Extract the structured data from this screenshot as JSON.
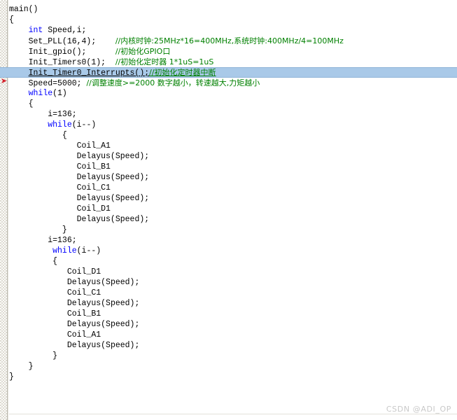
{
  "editor": {
    "gutter_marker_icon": "red-execution-arrow",
    "watermark": "CSDN @ADI_OP",
    "colors": {
      "keyword": "#0000ff",
      "comment": "#008000",
      "text": "#000000",
      "selection": "#a9c9e8",
      "gutter": "#fbfbf9",
      "marker": "#d4202a",
      "watermark": "#c9c9c9"
    }
  },
  "code": {
    "lines": [
      {
        "indent": 0,
        "parts": [
          {
            "t": "main()",
            "c": "plain"
          }
        ]
      },
      {
        "indent": 0,
        "parts": [
          {
            "t": "{",
            "c": "plain"
          }
        ]
      },
      {
        "indent": 4,
        "parts": [
          {
            "t": "int",
            "c": "kw"
          },
          {
            "t": " Speed,i;",
            "c": "plain"
          }
        ]
      },
      {
        "indent": 4,
        "parts": [
          {
            "t": "Set_PLL(16,4);    ",
            "c": "plain"
          },
          {
            "t": "//内核时钟:25MHz*16=400MHz,系统时钟:400MHz/4=100MHz",
            "c": "cmt"
          }
        ]
      },
      {
        "indent": 4,
        "parts": [
          {
            "t": "Init_gpio();      ",
            "c": "plain"
          },
          {
            "t": "//初始化GPIO口",
            "c": "cmt"
          }
        ]
      },
      {
        "indent": 4,
        "parts": [
          {
            "t": "Init_Timers0(1);  ",
            "c": "plain"
          },
          {
            "t": "//初始化定时器 1*1uS=1uS",
            "c": "cmt"
          }
        ]
      },
      {
        "indent": 4,
        "selected": true,
        "parts": [
          {
            "t": "Init_Timer0_Interrupts();",
            "c": "plain"
          },
          {
            "t": "//初始化定时器中断",
            "c": "cmt"
          }
        ]
      },
      {
        "indent": 4,
        "parts": [
          {
            "t": "Speed=5000; ",
            "c": "plain"
          },
          {
            "t": "//调整速度>=2000 数字越小，转速越大,力矩越小",
            "c": "cmt"
          }
        ]
      },
      {
        "indent": 4,
        "parts": [
          {
            "t": "while",
            "c": "kw"
          },
          {
            "t": "(1)",
            "c": "plain"
          }
        ]
      },
      {
        "indent": 4,
        "parts": [
          {
            "t": "{",
            "c": "plain"
          }
        ]
      },
      {
        "indent": 8,
        "parts": [
          {
            "t": "i=136;",
            "c": "plain"
          }
        ]
      },
      {
        "indent": 8,
        "parts": [
          {
            "t": "while",
            "c": "kw"
          },
          {
            "t": "(i--)",
            "c": "plain"
          }
        ]
      },
      {
        "indent": 11,
        "parts": [
          {
            "t": "{",
            "c": "plain"
          }
        ]
      },
      {
        "indent": 14,
        "parts": [
          {
            "t": "Coil_A1",
            "c": "plain"
          }
        ]
      },
      {
        "indent": 14,
        "parts": [
          {
            "t": "Delayus(Speed);",
            "c": "plain"
          }
        ]
      },
      {
        "indent": 14,
        "parts": [
          {
            "t": "Coil_B1",
            "c": "plain"
          }
        ]
      },
      {
        "indent": 14,
        "parts": [
          {
            "t": "Delayus(Speed);",
            "c": "plain"
          }
        ]
      },
      {
        "indent": 14,
        "parts": [
          {
            "t": "Coil_C1",
            "c": "plain"
          }
        ]
      },
      {
        "indent": 14,
        "parts": [
          {
            "t": "Delayus(Speed);",
            "c": "plain"
          }
        ]
      },
      {
        "indent": 14,
        "parts": [
          {
            "t": "Coil_D1",
            "c": "plain"
          }
        ]
      },
      {
        "indent": 14,
        "parts": [
          {
            "t": "Delayus(Speed);",
            "c": "plain"
          }
        ]
      },
      {
        "indent": 11,
        "parts": [
          {
            "t": "}",
            "c": "plain"
          }
        ]
      },
      {
        "indent": 8,
        "parts": [
          {
            "t": "i=136;",
            "c": "plain"
          }
        ]
      },
      {
        "indent": 9,
        "parts": [
          {
            "t": "while",
            "c": "kw"
          },
          {
            "t": "(i--)",
            "c": "plain"
          }
        ]
      },
      {
        "indent": 9,
        "parts": [
          {
            "t": "{",
            "c": "plain"
          }
        ]
      },
      {
        "indent": 12,
        "parts": [
          {
            "t": "Coil_D1",
            "c": "plain"
          }
        ]
      },
      {
        "indent": 12,
        "parts": [
          {
            "t": "Delayus(Speed);",
            "c": "plain"
          }
        ]
      },
      {
        "indent": 12,
        "parts": [
          {
            "t": "Coil_C1",
            "c": "plain"
          }
        ]
      },
      {
        "indent": 12,
        "parts": [
          {
            "t": "Delayus(Speed);",
            "c": "plain"
          }
        ]
      },
      {
        "indent": 12,
        "parts": [
          {
            "t": "Coil_B1",
            "c": "plain"
          }
        ]
      },
      {
        "indent": 12,
        "parts": [
          {
            "t": "Delayus(Speed);",
            "c": "plain"
          }
        ]
      },
      {
        "indent": 12,
        "parts": [
          {
            "t": "Coil_A1",
            "c": "plain"
          }
        ]
      },
      {
        "indent": 12,
        "parts": [
          {
            "t": "Delayus(Speed);",
            "c": "plain"
          }
        ]
      },
      {
        "indent": 9,
        "parts": [
          {
            "t": "}",
            "c": "plain"
          }
        ]
      },
      {
        "indent": 4,
        "parts": [
          {
            "t": "}",
            "c": "plain"
          }
        ]
      },
      {
        "indent": 0,
        "parts": [
          {
            "t": "}",
            "c": "plain"
          }
        ]
      }
    ]
  }
}
